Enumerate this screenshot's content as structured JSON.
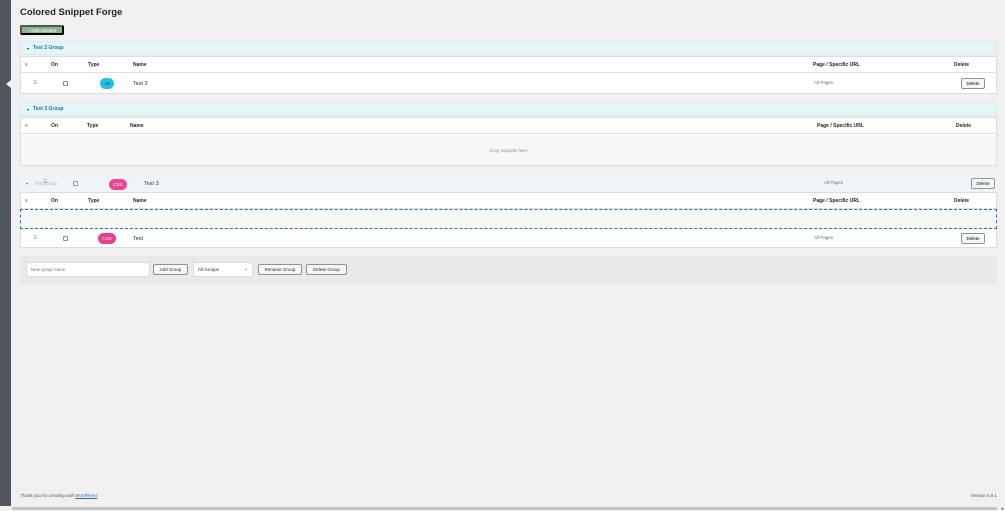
{
  "page": {
    "title": "Colored Snippet Forge",
    "add_snippet_label": "+ Add Snippet"
  },
  "columns": {
    "on": "On",
    "type": "Type",
    "name": "Name",
    "pages": "Page / Specific URL",
    "delete": "Delete"
  },
  "groups": [
    {
      "name": "Test 2 Group",
      "snippets": [
        {
          "type": "JS",
          "name": "Test 2",
          "pages": "All Pages",
          "delete_label": "Delete"
        }
      ]
    },
    {
      "name": "Test 3 Group",
      "empty_text": "Drag snippets here"
    },
    {
      "name": "Test Group",
      "snippets": [
        {
          "type": "CSS",
          "name": "Test",
          "pages": "All Pages",
          "delete_label": "Delete"
        }
      ]
    }
  ],
  "dragging": {
    "group_name": "Test Group",
    "snippet": {
      "type": "CSS",
      "name": "Test 3",
      "pages": "All Pages",
      "delete_label": "Delete"
    }
  },
  "controls": {
    "new_group_placeholder": "New group name",
    "add_group_label": "Add Group",
    "group_select_value": "All Groups",
    "rename_group_label": "Rename Group",
    "delete_group_label": "Delete Group"
  },
  "footer": {
    "thanks_prefix": "Thank you for creating with",
    "wordpress_link": "WordPress",
    "thanks_suffix": ".",
    "version": "Version 6.9.1"
  },
  "colors": {
    "js_pill": "#1ec3e0",
    "css_pill": "#e83e8c",
    "add_button": "#8ab391",
    "group_header": "#e3f5f7",
    "admin_bar": "#50575e"
  }
}
